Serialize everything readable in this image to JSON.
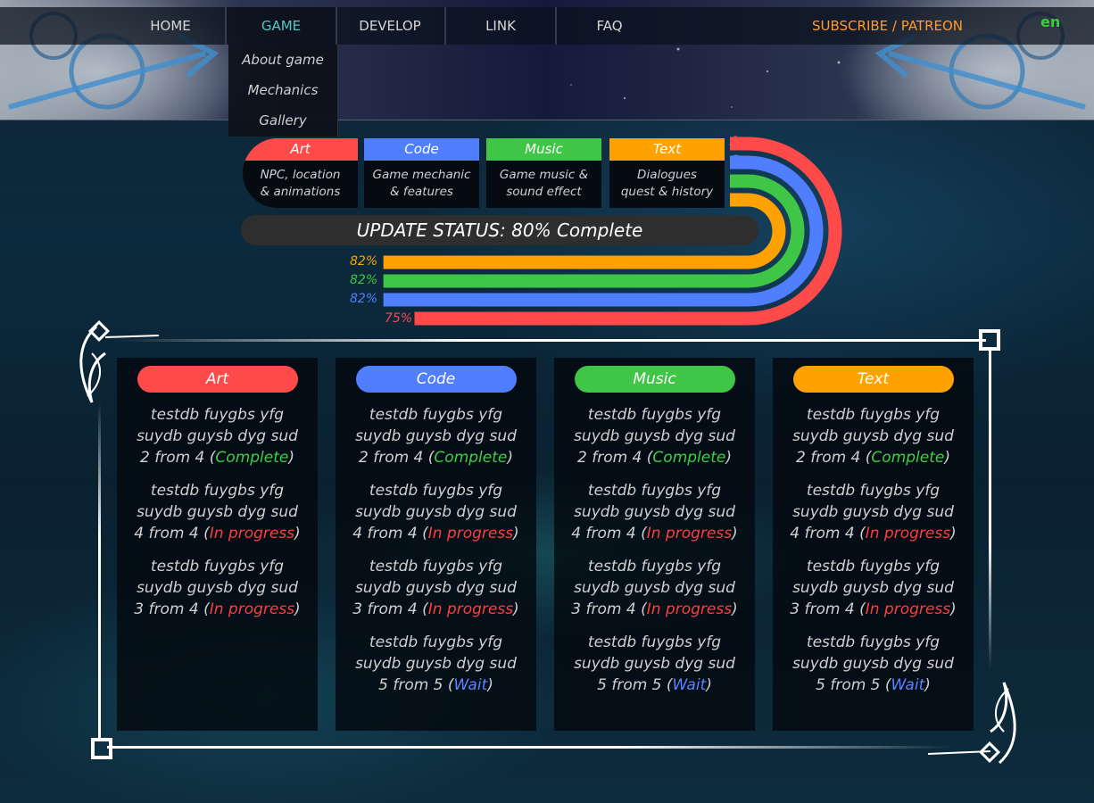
{
  "nav": {
    "items": [
      "HOME",
      "GAME",
      "DEVELOP",
      "LINK",
      "FAQ"
    ],
    "active": "GAME",
    "subscribe": "SUBSCRIBE / PATREON",
    "lang": "en"
  },
  "dropdown": {
    "items": [
      "About game",
      "Mechanics",
      "Gallery"
    ]
  },
  "categories": [
    {
      "label": "Art",
      "line1": "NPC, location",
      "line2": "& animations",
      "letter": "A",
      "color": "#ff4a4a"
    },
    {
      "label": "Code",
      "line1": "Game mechanic",
      "line2": "& features",
      "letter": "C",
      "color": "#4f7fff"
    },
    {
      "label": "Music",
      "line1": "Game music &",
      "line2": "sound effect",
      "letter": "M",
      "color": "#3fc646"
    },
    {
      "label": "Text",
      "line1": "Dialogues",
      "line2": "quest & history",
      "letter": "T",
      "color": "#ffa200"
    }
  ],
  "status": {
    "label": "UPDATE STATUS: 80% Complete",
    "bars": [
      {
        "category": "Text",
        "percent_label": "82%",
        "value": 82,
        "color": "#ffa200"
      },
      {
        "category": "Music",
        "percent_label": "82%",
        "value": 82,
        "color": "#3fc646"
      },
      {
        "category": "Code",
        "percent_label": "82%",
        "value": 82,
        "color": "#4f7fff"
      },
      {
        "category": "Art",
        "percent_label": "75%",
        "value": 75,
        "color": "#ff4a4a"
      }
    ]
  },
  "panels": [
    {
      "title": "Art",
      "color": "#ff4a4a",
      "tasks": [
        {
          "l1": "testdb fuygbs yfg",
          "l2": "suydb guysb dyg sud",
          "prog": "2 from 4",
          "status": "Complete",
          "kind": "complete"
        },
        {
          "l1": "testdb fuygbs yfg",
          "l2": "suydb guysb dyg sud",
          "prog": "4 from 4",
          "status": "In progress",
          "kind": "progress"
        },
        {
          "l1": "testdb fuygbs yfg",
          "l2": "suydb guysb dyg sud",
          "prog": "3 from 4",
          "status": "In progress",
          "kind": "progress"
        }
      ]
    },
    {
      "title": "Code",
      "color": "#4f7fff",
      "tasks": [
        {
          "l1": "testdb fuygbs yfg",
          "l2": "suydb guysb dyg sud",
          "prog": "2 from 4",
          "status": "Complete",
          "kind": "complete"
        },
        {
          "l1": "testdb fuygbs yfg",
          "l2": "suydb guysb dyg sud",
          "prog": "4 from 4",
          "status": "In progress",
          "kind": "progress"
        },
        {
          "l1": "testdb fuygbs yfg",
          "l2": "suydb guysb dyg sud",
          "prog": "3 from 4",
          "status": "In progress",
          "kind": "progress"
        },
        {
          "l1": "testdb fuygbs yfg",
          "l2": "suydb guysb dyg sud",
          "prog": "5 from 5",
          "status": "Wait",
          "kind": "wait"
        }
      ]
    },
    {
      "title": "Music",
      "color": "#3fc646",
      "tasks": [
        {
          "l1": "testdb fuygbs yfg",
          "l2": "suydb guysb dyg sud",
          "prog": "2 from 4",
          "status": "Complete",
          "kind": "complete"
        },
        {
          "l1": "testdb fuygbs yfg",
          "l2": "suydb guysb dyg sud",
          "prog": "4 from 4",
          "status": "In progress",
          "kind": "progress"
        },
        {
          "l1": "testdb fuygbs yfg",
          "l2": "suydb guysb dyg sud",
          "prog": "3 from 4",
          "status": "In progress",
          "kind": "progress"
        },
        {
          "l1": "testdb fuygbs yfg",
          "l2": "suydb guysb dyg sud",
          "prog": "5 from 5",
          "status": "Wait",
          "kind": "wait"
        }
      ]
    },
    {
      "title": "Text",
      "color": "#ffa200",
      "tasks": [
        {
          "l1": "testdb fuygbs yfg",
          "l2": "suydb guysb dyg sud",
          "prog": "2 from 4",
          "status": "Complete",
          "kind": "complete"
        },
        {
          "l1": "testdb fuygbs yfg",
          "l2": "suydb guysb dyg sud",
          "prog": "4 from 4",
          "status": "In progress",
          "kind": "progress"
        },
        {
          "l1": "testdb fuygbs yfg",
          "l2": "suydb guysb dyg sud",
          "prog": "3 from 4",
          "status": "In progress",
          "kind": "progress"
        },
        {
          "l1": "testdb fuygbs yfg",
          "l2": "suydb guysb dyg sud",
          "prog": "5 from 5",
          "status": "Wait",
          "kind": "wait"
        }
      ]
    }
  ]
}
